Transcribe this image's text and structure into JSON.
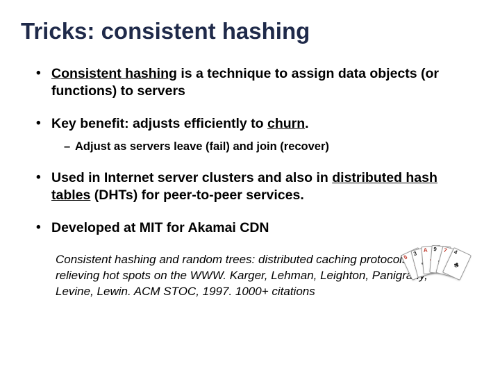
{
  "title": "Tricks: consistent hashing",
  "bullets": {
    "b1_lead": "Consistent hashing",
    "b1_rest": " is a technique to assign data objects (or functions) to servers",
    "b2_pre": "Key benefit: adjusts efficiently to ",
    "b2_em": "churn",
    "b2_post": ".",
    "b2_sub": "Adjust as servers leave (fail) and join (recover)",
    "b3_pre": "Used in Internet server clusters and also in ",
    "b3_em": "distributed hash tables",
    "b3_post": " (DHTs) for peer-to-peer services.",
    "b4": "Developed at MIT for Akamai CDN"
  },
  "reference": {
    "title": "Consistent hashing and random trees: distributed caching protocols for relieving hot spots on the WWW.",
    "rest": "  Karger, Lehman, Leighton, Panigrahy, Levine, Lewin.  ACM STOC, 1997.  1000+ citations"
  },
  "cards": [
    {
      "rank": "5",
      "suit": "♦",
      "color": "red"
    },
    {
      "rank": "3",
      "suit": "♣",
      "color": "black"
    },
    {
      "rank": "A",
      "suit": "♥",
      "color": "red"
    },
    {
      "rank": "9",
      "suit": "♠",
      "color": "black"
    },
    {
      "rank": "7",
      "suit": "♦",
      "color": "red"
    },
    {
      "rank": "4",
      "suit": "♣",
      "color": "black"
    }
  ]
}
